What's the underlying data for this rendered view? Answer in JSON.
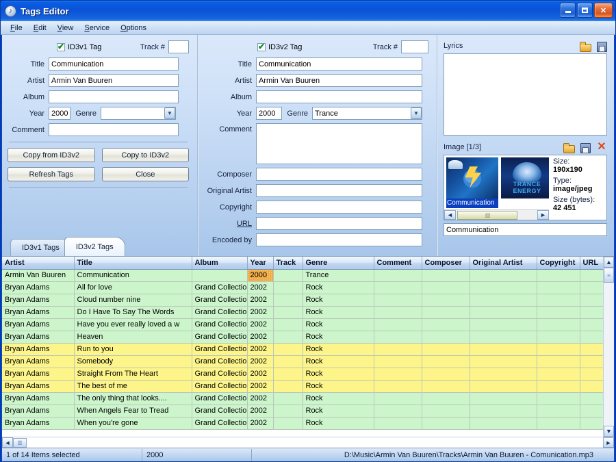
{
  "window": {
    "title": "Tags Editor",
    "icon": "app-note-icon",
    "controls": {
      "minimize": "_",
      "maximize": "□",
      "close": "✕"
    }
  },
  "menu": {
    "items": [
      "File",
      "Edit",
      "View",
      "Service",
      "Options"
    ]
  },
  "id3v1": {
    "checkbox_label": "ID3v1 Tag",
    "checked": true,
    "track_label": "Track #",
    "track_value": "",
    "fields": [
      {
        "label": "Title",
        "value": "Communication"
      },
      {
        "label": "Artist",
        "value": "Armin Van Buuren"
      },
      {
        "label": "Album",
        "value": ""
      }
    ],
    "year_label": "Year",
    "year_value": "2000",
    "genre_label": "Genre",
    "genre_value": "",
    "comment_label": "Comment",
    "comment_value": "",
    "buttons": {
      "copy_from": "Copy from ID3v2",
      "copy_to": "Copy to ID3v2",
      "refresh": "Refresh Tags",
      "close": "Close"
    }
  },
  "id3v2": {
    "checkbox_label": "ID3v2 Tag",
    "checked": true,
    "track_label": "Track #",
    "track_value": "",
    "fields": [
      {
        "label": "Title",
        "value": "Communication"
      },
      {
        "label": "Artist",
        "value": "Armin Van Buuren"
      },
      {
        "label": "Album",
        "value": ""
      }
    ],
    "year_label": "Year",
    "year_value": "2000",
    "genre_label": "Genre",
    "genre_value": "Trance",
    "comment_label": "Comment",
    "comment_value": "",
    "extra_fields": [
      {
        "label": "Composer",
        "value": ""
      },
      {
        "label": "Original Artist",
        "value": ""
      },
      {
        "label": "Copyright",
        "value": ""
      },
      {
        "label": "URL",
        "value": ""
      },
      {
        "label": "Encoded by",
        "value": ""
      }
    ]
  },
  "lyrics": {
    "title": "Lyrics",
    "value": "",
    "icons": [
      "open-folder-icon",
      "save-icon"
    ]
  },
  "image": {
    "title": "Image [1/3]",
    "icons": [
      "open-folder-icon",
      "save-icon",
      "delete-icon"
    ],
    "thumbnails": [
      {
        "caption": "Communication",
        "selected": true
      },
      {
        "caption": "TRANCE ENERGY",
        "selected": false
      }
    ],
    "meta": [
      {
        "key": "Size:",
        "value": "190x190"
      },
      {
        "key": "Type:",
        "value": "image/jpeg"
      },
      {
        "key": "Size (bytes):",
        "value": "42 451"
      }
    ],
    "description_value": "Communication"
  },
  "tabs": [
    {
      "label": "ID3v1 Tags",
      "active": false
    },
    {
      "label": "ID3v2 Tags",
      "active": true
    }
  ],
  "grid": {
    "columns": [
      "Artist",
      "Title",
      "Album",
      "Year",
      "Track",
      "Genre",
      "Comment",
      "Composer",
      "Original Artist",
      "Copyright",
      "URL"
    ],
    "rows": [
      {
        "color": "green",
        "highlight_col": 3,
        "cells": [
          "Armin Van Buuren",
          "Communication",
          "",
          "2000",
          "",
          "Trance",
          "",
          "",
          "",
          "",
          ""
        ]
      },
      {
        "color": "green",
        "highlight_col": -1,
        "cells": [
          "Bryan Adams",
          "All for love",
          "Grand Collection",
          "2002",
          "",
          "Rock",
          "",
          "",
          "",
          "",
          ""
        ]
      },
      {
        "color": "green",
        "highlight_col": -1,
        "cells": [
          "Bryan Adams",
          "Cloud number nine",
          "Grand Collection",
          "2002",
          "",
          "Rock",
          "",
          "",
          "",
          "",
          ""
        ]
      },
      {
        "color": "green",
        "highlight_col": -1,
        "cells": [
          "Bryan Adams",
          "Do I Have To Say The Words",
          "Grand Collection",
          "2002",
          "",
          "Rock",
          "",
          "",
          "",
          "",
          ""
        ]
      },
      {
        "color": "green",
        "highlight_col": -1,
        "cells": [
          "Bryan Adams",
          "Have you ever really loved a w",
          "Grand Collection",
          "2002",
          "",
          "Rock",
          "",
          "",
          "",
          "",
          ""
        ]
      },
      {
        "color": "green",
        "highlight_col": -1,
        "cells": [
          "Bryan Adams",
          "Heaven",
          "Grand Collection",
          "2002",
          "",
          "Rock",
          "",
          "",
          "",
          "",
          ""
        ]
      },
      {
        "color": "yellow",
        "highlight_col": -1,
        "cells": [
          "Bryan Adams",
          "Run to you",
          "Grand Collection",
          "2002",
          "",
          "Rock",
          "",
          "",
          "",
          "",
          ""
        ]
      },
      {
        "color": "yellow",
        "highlight_col": -1,
        "cells": [
          "Bryan Adams",
          "Somebody",
          "Grand Collection",
          "2002",
          "",
          "Rock",
          "",
          "",
          "",
          "",
          ""
        ]
      },
      {
        "color": "yellow",
        "highlight_col": -1,
        "cells": [
          "Bryan Adams",
          "Straight From The Heart",
          "Grand Collection",
          "2002",
          "",
          "Rock",
          "",
          "",
          "",
          "",
          ""
        ]
      },
      {
        "color": "yellow",
        "highlight_col": -1,
        "cells": [
          "Bryan Adams",
          "The best of me",
          "Grand Collection",
          "2002",
          "",
          "Rock",
          "",
          "",
          "",
          "",
          ""
        ]
      },
      {
        "color": "green",
        "highlight_col": -1,
        "cells": [
          "Bryan Adams",
          "The  only thing that looks....",
          "Grand Collection",
          "2002",
          "",
          "Rock",
          "",
          "",
          "",
          "",
          ""
        ]
      },
      {
        "color": "green",
        "highlight_col": -1,
        "cells": [
          "Bryan Adams",
          "When Angels Fear to Tread",
          "Grand Collection",
          "2002",
          "",
          "Rock",
          "",
          "",
          "",
          "",
          ""
        ]
      },
      {
        "color": "green",
        "highlight_col": -1,
        "cells": [
          "Bryan Adams",
          "When you're gone",
          "Grand Collection",
          "2002",
          "",
          "Rock",
          "",
          "",
          "",
          "",
          ""
        ]
      }
    ]
  },
  "statusbar": {
    "selection": "1 of 14 Items selected",
    "year": "2000",
    "path": "D:\\Music\\Armin Van Buuren\\Tracks\\Armin Van Buuren - Comunication.mp3"
  },
  "colors": {
    "title_blue": "#0a52d8",
    "row_green": "#ccf5cc",
    "row_yellow": "#fdf58a",
    "cell_highlight": "#f0a93c",
    "panel_blue": "#bed5f2"
  }
}
